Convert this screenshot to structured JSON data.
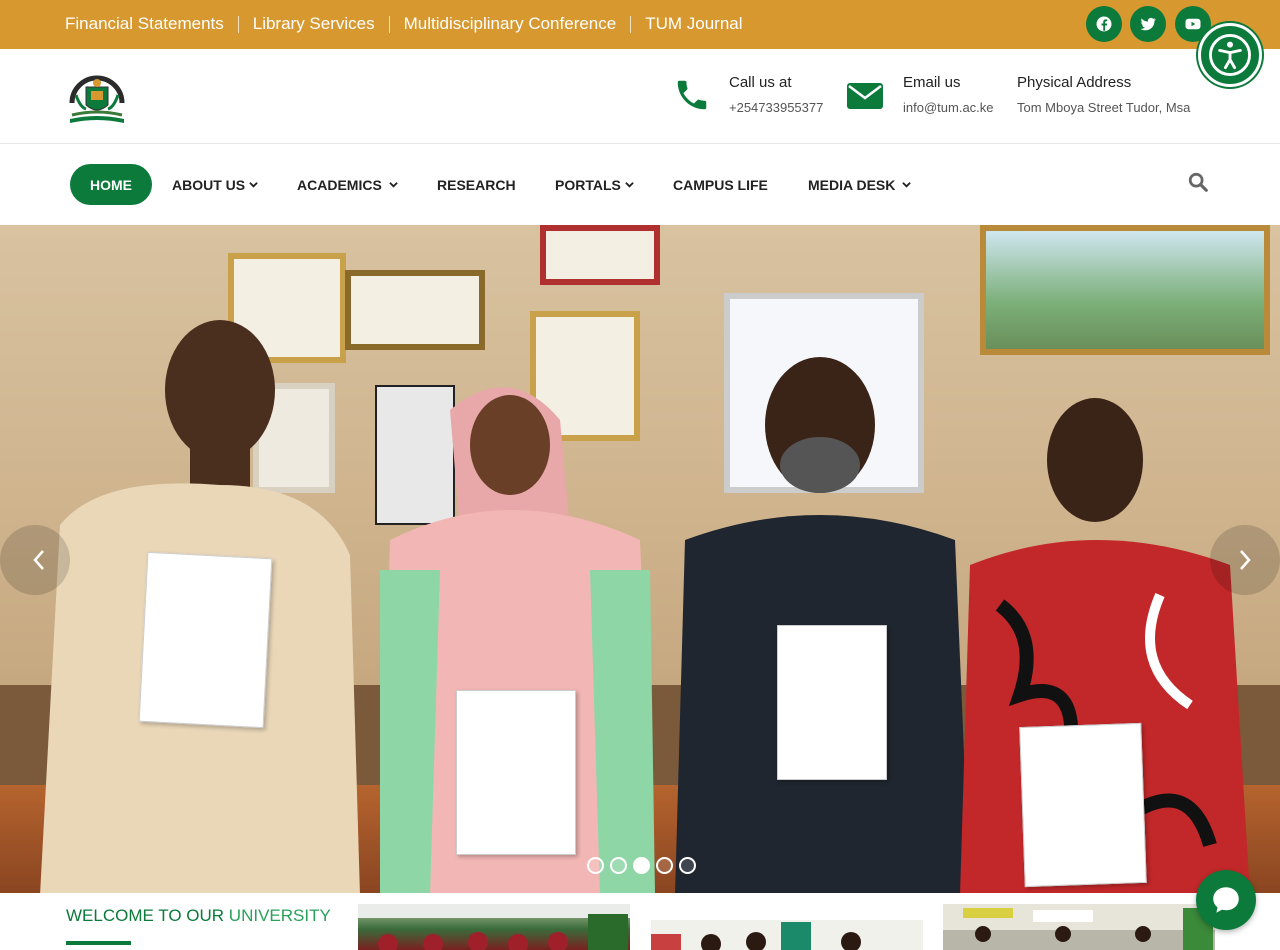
{
  "topbar": {
    "links": [
      "Financial Statements",
      "Library Services",
      "Multidisciplinary Conference",
      "TUM Journal"
    ],
    "social": [
      "facebook-icon",
      "twitter-icon",
      "youtube-icon"
    ],
    "color": "#d7982f"
  },
  "header": {
    "call_label": "Call us at",
    "call_value": "+254733955377",
    "email_label": "Email us",
    "email_value": "info@tum.ac.ke",
    "address_label": "Physical Address",
    "address_value": "Tom Mboya Street Tudor, Msa"
  },
  "nav": {
    "home": "HOME",
    "about": "ABOUT US",
    "academics": "ACADEMICS",
    "research": "RESEARCH",
    "portals": "PORTALS",
    "campus": "CAMPUS LIFE",
    "media": "MEDIA DESK"
  },
  "hero": {
    "slide_count": 5,
    "active_slide": 3
  },
  "welcome": {
    "prefix": "WELCOME TO OUR",
    "accent": "UNIVERSITY"
  },
  "colors": {
    "brand": "#0b7a3b",
    "accent": "#d7982f"
  }
}
